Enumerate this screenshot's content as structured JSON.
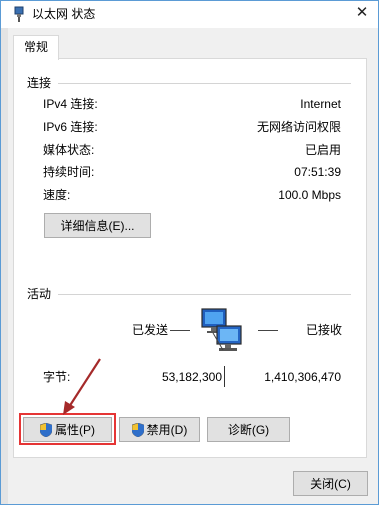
{
  "window": {
    "title": "以太网 状态",
    "close_glyph": "✕"
  },
  "tabs": [
    {
      "label": "常规"
    }
  ],
  "connection": {
    "group_title": "连接",
    "rows": [
      {
        "label": "IPv4 连接:",
        "value": "Internet"
      },
      {
        "label": "IPv6 连接:",
        "value": "无网络访问权限"
      },
      {
        "label": "媒体状态:",
        "value": "已启用"
      },
      {
        "label": "持续时间:",
        "value": "07:51:39"
      },
      {
        "label": "速度:",
        "value": "100.0 Mbps"
      }
    ],
    "details_button": "详细信息(E)..."
  },
  "activity": {
    "group_title": "活动",
    "sent_label": "已发送",
    "received_label": "已接收",
    "bytes_label": "字节:",
    "bytes_sent": "53,182,300",
    "bytes_received": "1,410,306,470"
  },
  "actions": {
    "properties": "属性(P)",
    "disable": "禁用(D)",
    "diagnose": "诊断(G)"
  },
  "footer": {
    "close_button": "关闭(C)"
  },
  "colors": {
    "highlight": "#e53535",
    "annotation_arrow": "#a52a2a",
    "window_border": "#5b9bd5"
  },
  "icons": [
    "network-adapter-icon",
    "shield-icon",
    "network-computers-icon",
    "close-icon"
  ]
}
